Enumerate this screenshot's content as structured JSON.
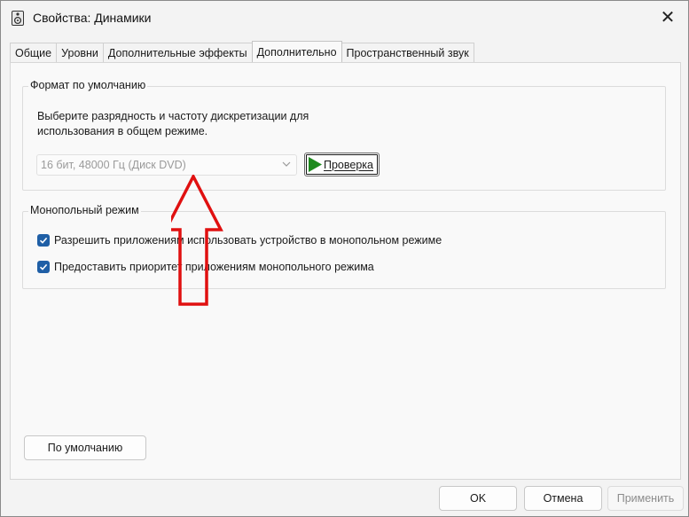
{
  "window": {
    "title": "Свойства: Динамики",
    "close_glyph": "✕"
  },
  "tabs": [
    {
      "label": "Общие",
      "active": false
    },
    {
      "label": "Уровни",
      "active": false
    },
    {
      "label": "Дополнительные эффекты",
      "active": false
    },
    {
      "label": "Дополнительно",
      "active": true
    },
    {
      "label": "Пространственный звук",
      "active": false
    }
  ],
  "default_format": {
    "group_title": "Формат по умолчанию",
    "description": "Выберите разрядность и частоту дискретизации для использования в общем режиме.",
    "format_value": "16 бит, 48000 Гц (Диск DVD)",
    "test_button": "Проверка"
  },
  "exclusive_mode": {
    "group_title": "Монопольный режим",
    "allow_exclusive": {
      "label": "Разрешить приложениям использовать устройство в монопольном режиме",
      "checked": true
    },
    "give_priority": {
      "label": "Предоставить приоритет приложениям монопольного режима",
      "checked": true
    }
  },
  "restore_defaults_button": "По умолчанию",
  "footer": {
    "ok": "OK",
    "cancel": "Отмена",
    "apply": "Применить",
    "apply_enabled": false
  },
  "colors": {
    "checkbox": "#1f5fa6",
    "play_icon": "#1e8a1e",
    "annotation_arrow": "#e01010"
  },
  "annotation": {
    "type": "arrow-up",
    "color": "#e01010"
  }
}
